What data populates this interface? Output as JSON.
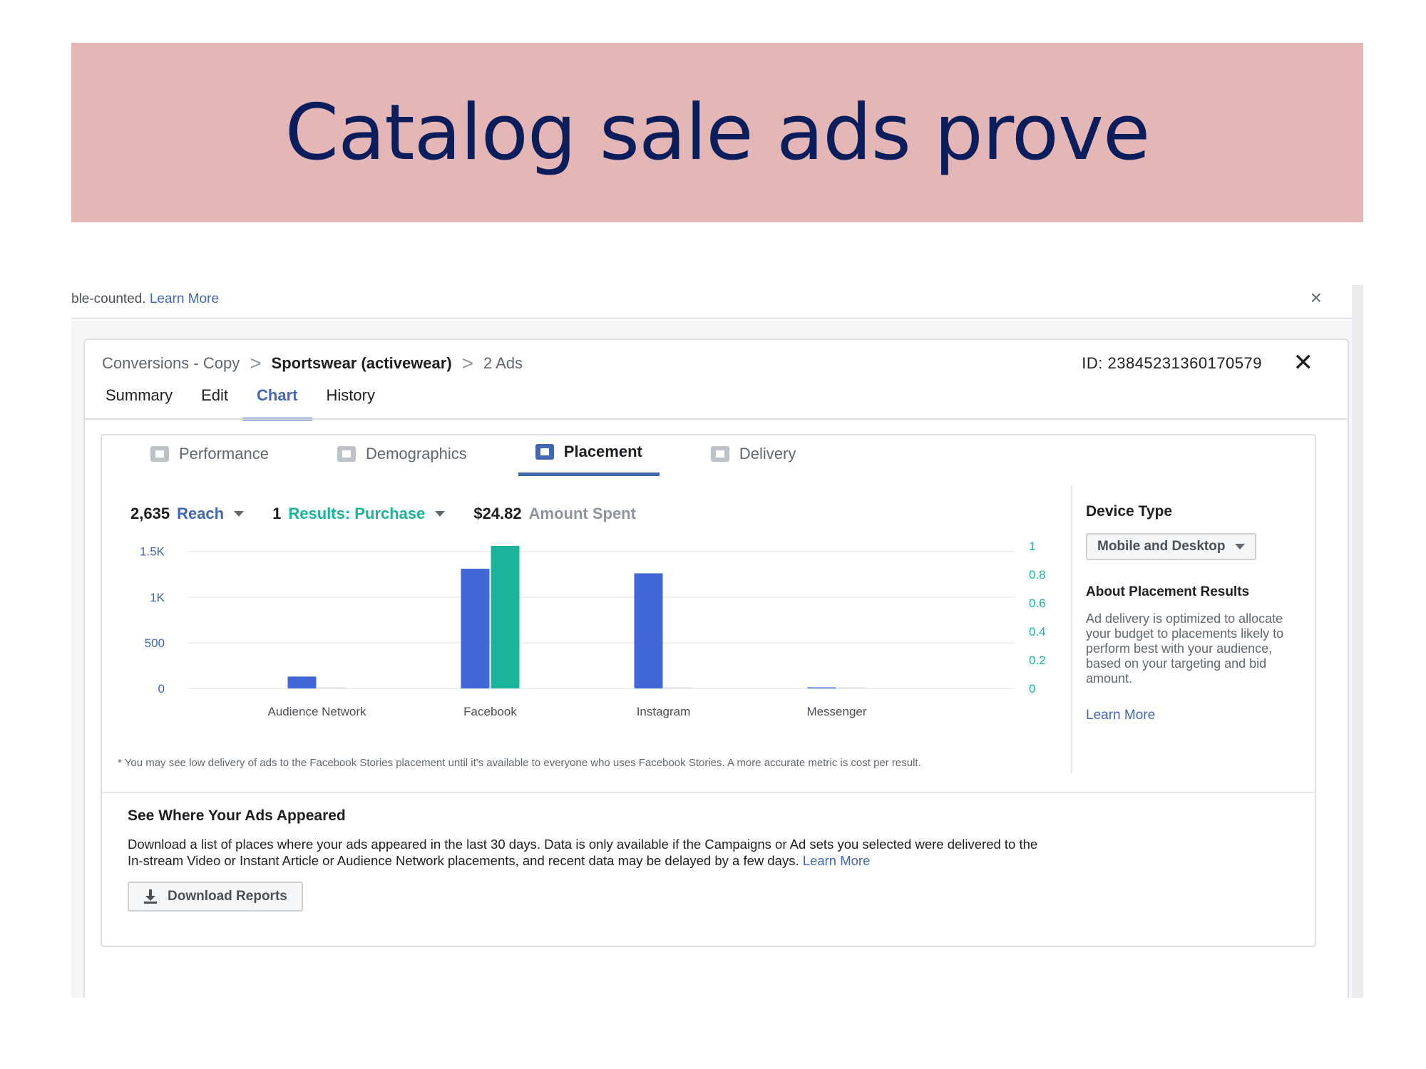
{
  "slide": {
    "title": "Catalog sale ads prove"
  },
  "notice": {
    "text": "ble-counted.",
    "link": "Learn More",
    "close": "×"
  },
  "breadcrumb": {
    "item1": "Conversions - Copy",
    "item2": "Sportswear (activewear)",
    "item3": "2 Ads",
    "sep": ">"
  },
  "panel": {
    "id_label": "ID: 23845231360170579",
    "close": "✕"
  },
  "tabs": [
    {
      "label": "Summary"
    },
    {
      "label": "Edit"
    },
    {
      "label": "Chart"
    },
    {
      "label": "History"
    }
  ],
  "subtabs": [
    {
      "label": "Performance"
    },
    {
      "label": "Demographics"
    },
    {
      "label": "Placement"
    },
    {
      "label": "Delivery"
    }
  ],
  "metrics": {
    "reach_value": "2,635",
    "reach_label": "Reach",
    "results_value": "1",
    "results_label": "Results: Purchase",
    "spent_value": "$24.82",
    "spent_label": "Amount Spent"
  },
  "colors": {
    "accent": "#4267b2",
    "bar_reach": "#4267d6",
    "bar_results": "#19b499"
  },
  "chart_data": {
    "type": "bar",
    "categories": [
      "Audience Network",
      "Facebook",
      "Instagram",
      "Messenger"
    ],
    "series": [
      {
        "name": "Reach",
        "axis": "left",
        "values": [
          130,
          1310,
          1260,
          10
        ]
      },
      {
        "name": "Results: Purchase",
        "axis": "right",
        "values": [
          0,
          1,
          0,
          0
        ]
      }
    ],
    "y_left": {
      "ticks": [
        "0",
        "500",
        "1K",
        "1.5K"
      ],
      "tick_values": [
        0,
        500,
        1000,
        1500
      ],
      "range": [
        0,
        1560
      ]
    },
    "y_right": {
      "ticks": [
        "0",
        "0.2",
        "0.4",
        "0.6",
        "0.8",
        "1"
      ],
      "tick_values": [
        0,
        0.2,
        0.4,
        0.6,
        0.8,
        1
      ],
      "range": [
        0,
        1
      ]
    },
    "grid": true
  },
  "footnote": "* You may see low delivery of ads to the Facebook Stories placement until it's available to everyone who uses Facebook Stories. A more accurate metric is cost per result.",
  "side": {
    "device_heading": "Device Type",
    "device_value": "Mobile and Desktop",
    "about_heading": "About Placement Results",
    "about_text": "Ad delivery is optimized to allocate your budget to placements likely to perform best with your audience, based on your targeting and bid amount.",
    "link": "Learn More"
  },
  "appeared": {
    "heading": "See Where Your Ads Appeared",
    "text": "Download a list of places where your ads appeared in the last 30 days. Data is only available if the Campaigns or Ad sets you selected were delivered to the In-stream Video or Instant Article or Audience Network placements, and recent data may be delayed by a few days.",
    "link": "Learn More",
    "button": "Download Reports"
  }
}
